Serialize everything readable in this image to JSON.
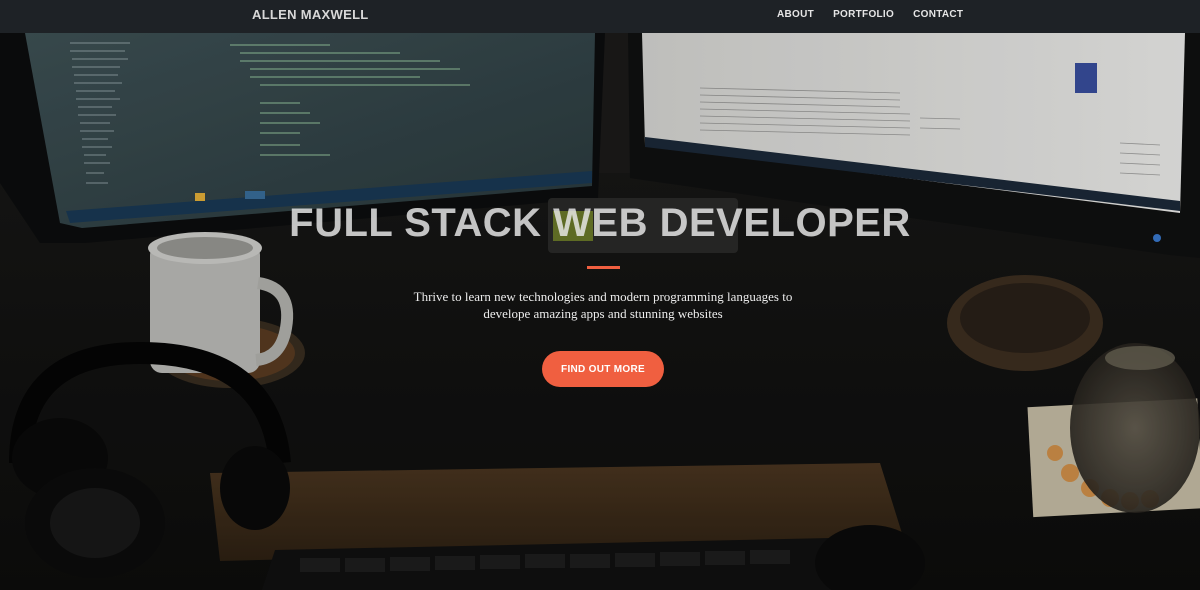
{
  "navbar": {
    "brand": "ALLEN MAXWELL",
    "links": [
      "ABOUT",
      "PORTFOLIO",
      "CONTACT"
    ]
  },
  "hero": {
    "title": "FULL STACK WEB DEVELOPER",
    "subtitle_line1": "Thrive to learn new technologies and modern programming languages to",
    "subtitle_line2": "develope amazing apps and stunning websites",
    "cta_label": "FIND OUT MORE"
  },
  "colors": {
    "accent": "#f05f40",
    "navbar_bg": "#1e2226"
  },
  "background_image": "desk-workstation-photo"
}
